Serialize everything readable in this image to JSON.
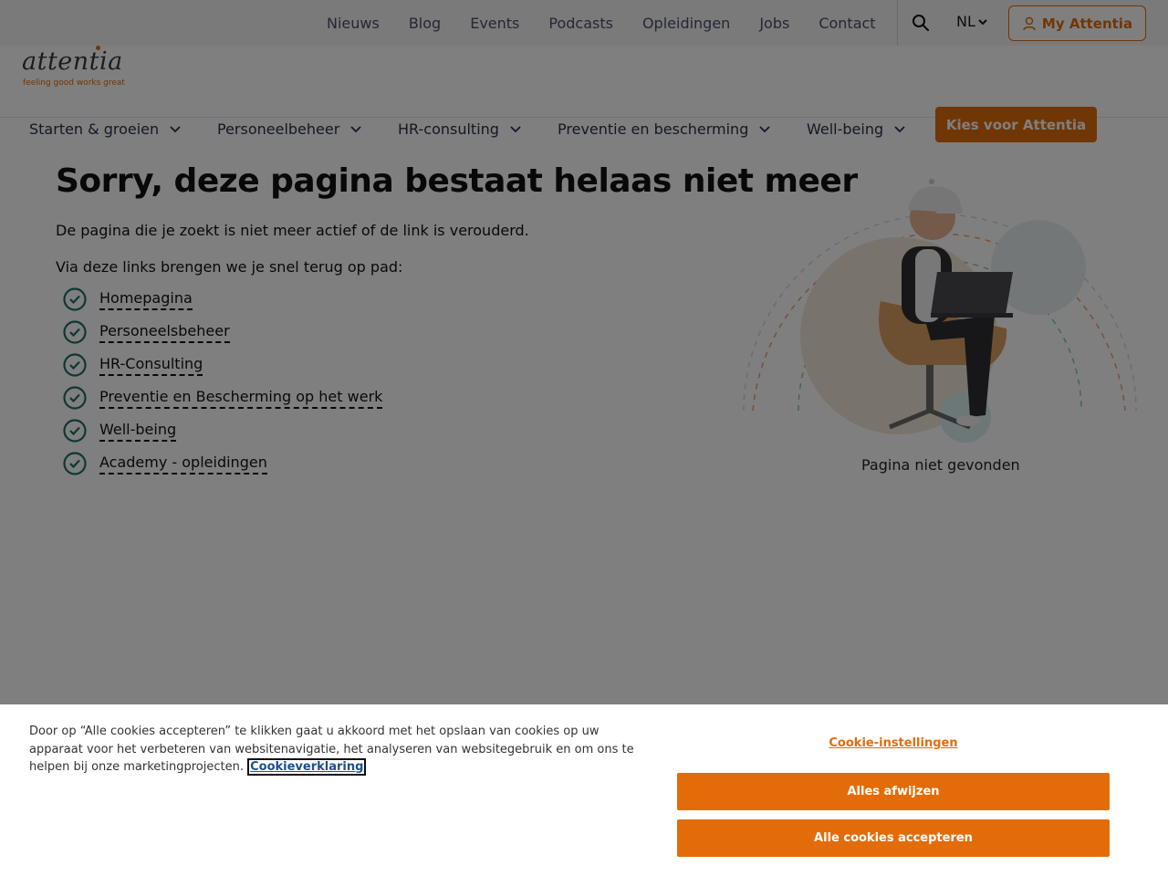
{
  "topnav": {
    "items": [
      "Nieuws",
      "Blog",
      "Events",
      "Podcasts",
      "Opleidingen",
      "Jobs",
      "Contact"
    ],
    "language": "NL",
    "my_attentia": "My Attentia"
  },
  "logo": {
    "word": "attentia",
    "tagline": "feeling good works great"
  },
  "mainnav": {
    "items": [
      "Starten & groeien",
      "Personeelbeheer",
      "HR-consulting",
      "Preventie en bescherming",
      "Well-being"
    ],
    "cta": "Kies voor Attentia"
  },
  "content": {
    "title": "Sorry, deze pagina bestaat helaas niet meer",
    "intro": "De pagina die je zoekt is niet meer actief of de link is verouderd.",
    "links_intro": "Via deze links brengen we je snel terug op pad:",
    "links": [
      "Homepagina",
      "Personeelsbeheer",
      "HR-Consulting",
      "Preventie en Bescherming op het werk",
      "Well-being",
      "Academy - opleidingen"
    ],
    "image_caption": "Pagina niet gevonden"
  },
  "cookie": {
    "text": "Door op “Alle cookies accepteren” te klikken gaat u akkoord met het opslaan van cookies op uw apparaat voor het verbeteren van websitenavigatie, het analyseren van websitegebruik en om ons te helpen bij onze marketingprojecten.",
    "policy_link": "Cookieverklaring",
    "settings": "Cookie-instellingen",
    "reject": "Alles afwijzen",
    "accept": "Alle cookies accepteren"
  },
  "colors": {
    "brand_orange": "#e36c0a",
    "check_teal": "#1f6f6a",
    "overlay": "rgba(0,0,0,0.5)"
  }
}
